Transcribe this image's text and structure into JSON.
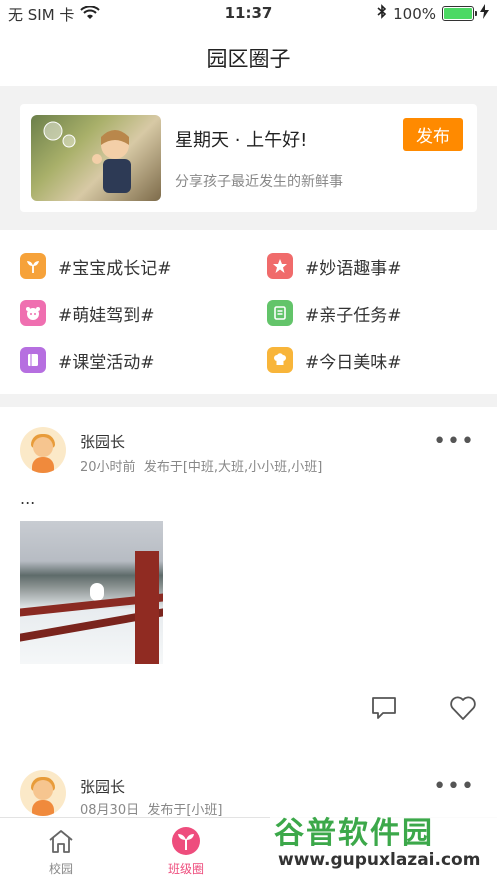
{
  "status_bar": {
    "carrier": "无 SIM 卡",
    "time": "11:37",
    "battery": "100%"
  },
  "nav": {
    "title": "园区圈子"
  },
  "composer": {
    "greeting": "星期天 · 上午好!",
    "subtitle": "分享孩子最近发生的新鲜事",
    "publish_label": "发布"
  },
  "topics": [
    {
      "label": "#宝宝成长记#",
      "color": "#f6a23a",
      "icon": "sprout-icon"
    },
    {
      "label": "#妙语趣事#",
      "color": "#f06b6b",
      "icon": "star-icon"
    },
    {
      "label": "#萌娃驾到#",
      "color": "#ef6fb0",
      "icon": "baby-face-icon"
    },
    {
      "label": "#亲子任务#",
      "color": "#63c46a",
      "icon": "checklist-icon"
    },
    {
      "label": "#课堂活动#",
      "color": "#b66fe0",
      "icon": "notebook-icon"
    },
    {
      "label": "#今日美味#",
      "color": "#f8b53a",
      "icon": "chef-hat-icon"
    }
  ],
  "posts": [
    {
      "author": "张园长",
      "time": "20小时前",
      "published_to": "发布于[中班,大班,小小班,小班]",
      "text": "...",
      "has_image": true
    },
    {
      "author": "张园长",
      "time": "08月30日",
      "published_to": "发布于[小班]",
      "text": "",
      "has_image": false
    }
  ],
  "tabbar": {
    "tabs": [
      {
        "label": "校园",
        "icon": "house-icon"
      },
      {
        "label": "班级圈",
        "icon": "sprout-circle-icon"
      }
    ]
  },
  "watermark": {
    "line1": "谷普软件园",
    "line2": "www.gupuxlazai.com"
  },
  "colors": {
    "accent": "#ff8a00",
    "tab_active": "#ee4d7d",
    "bg": "#f2f2f2"
  }
}
